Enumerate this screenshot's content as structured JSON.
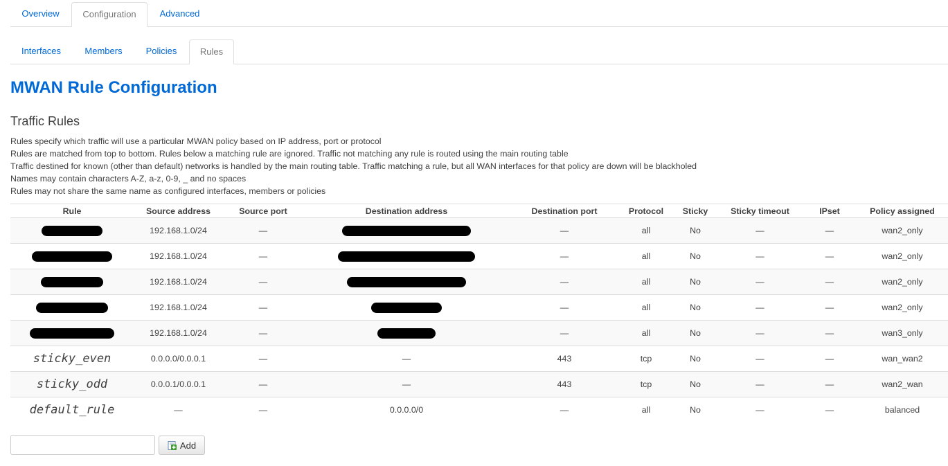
{
  "top_tabs": [
    {
      "label": "Overview",
      "active": false
    },
    {
      "label": "Configuration",
      "active": true
    },
    {
      "label": "Advanced",
      "active": false
    }
  ],
  "sub_tabs": [
    {
      "label": "Interfaces",
      "active": false
    },
    {
      "label": "Members",
      "active": false
    },
    {
      "label": "Policies",
      "active": false
    },
    {
      "label": "Rules",
      "active": true
    }
  ],
  "page_title": "MWAN Rule Configuration",
  "section_title": "Traffic Rules",
  "description": [
    "Rules specify which traffic will use a particular MWAN policy based on IP address, port or protocol",
    "Rules are matched from top to bottom. Rules below a matching rule are ignored. Traffic not matching any rule is routed using the main routing table",
    "Traffic destined for known (other than default) networks is handled by the main routing table. Traffic matching a rule, but all WAN interfaces for that policy are down will be blackholed",
    "Names may contain characters A-Z, a-z, 0-9, _ and no spaces",
    "Rules may not share the same name as configured interfaces, members or policies"
  ],
  "table": {
    "headers": [
      "Rule",
      "Source address",
      "Source port",
      "Destination address",
      "Destination port",
      "Protocol",
      "Sticky",
      "Sticky timeout",
      "IPset",
      "Policy assigned"
    ],
    "rows": [
      {
        "rule": "",
        "src": "192.168.1.0/24",
        "sport": "—",
        "dst": "",
        "dport": "—",
        "proto": "all",
        "sticky": "No",
        "timeout": "—",
        "ipset": "—",
        "policy": "wan2_only"
      },
      {
        "rule": "",
        "src": "192.168.1.0/24",
        "sport": "—",
        "dst": "",
        "dport": "—",
        "proto": "all",
        "sticky": "No",
        "timeout": "—",
        "ipset": "—",
        "policy": "wan2_only"
      },
      {
        "rule": "",
        "src": "192.168.1.0/24",
        "sport": "—",
        "dst": "",
        "dport": "—",
        "proto": "all",
        "sticky": "No",
        "timeout": "—",
        "ipset": "—",
        "policy": "wan2_only"
      },
      {
        "rule": "",
        "src": "192.168.1.0/24",
        "sport": "—",
        "dst": "",
        "dport": "—",
        "proto": "all",
        "sticky": "No",
        "timeout": "—",
        "ipset": "—",
        "policy": "wan2_only"
      },
      {
        "rule": "",
        "src": "192.168.1.0/24",
        "sport": "—",
        "dst": "",
        "dport": "—",
        "proto": "all",
        "sticky": "No",
        "timeout": "—",
        "ipset": "—",
        "policy": "wan3_only"
      },
      {
        "rule": "sticky_even",
        "src": "0.0.0.0/0.0.0.1",
        "sport": "—",
        "dst": "—",
        "dport": "443",
        "proto": "tcp",
        "sticky": "No",
        "timeout": "—",
        "ipset": "—",
        "policy": "wan_wan2"
      },
      {
        "rule": "sticky_odd",
        "src": "0.0.0.1/0.0.0.1",
        "sport": "—",
        "dst": "—",
        "dport": "443",
        "proto": "tcp",
        "sticky": "No",
        "timeout": "—",
        "ipset": "—",
        "policy": "wan2_wan"
      },
      {
        "rule": "default_rule",
        "src": "—",
        "sport": "—",
        "dst": "0.0.0.0/0",
        "dport": "—",
        "proto": "all",
        "sticky": "No",
        "timeout": "—",
        "ipset": "—",
        "policy": "balanced"
      }
    ]
  },
  "add": {
    "input_value": "",
    "button_label": "Add",
    "icon": "add-document-icon"
  },
  "colors": {
    "link": "#0069d6",
    "text": "#404040",
    "border": "#dddddd"
  }
}
